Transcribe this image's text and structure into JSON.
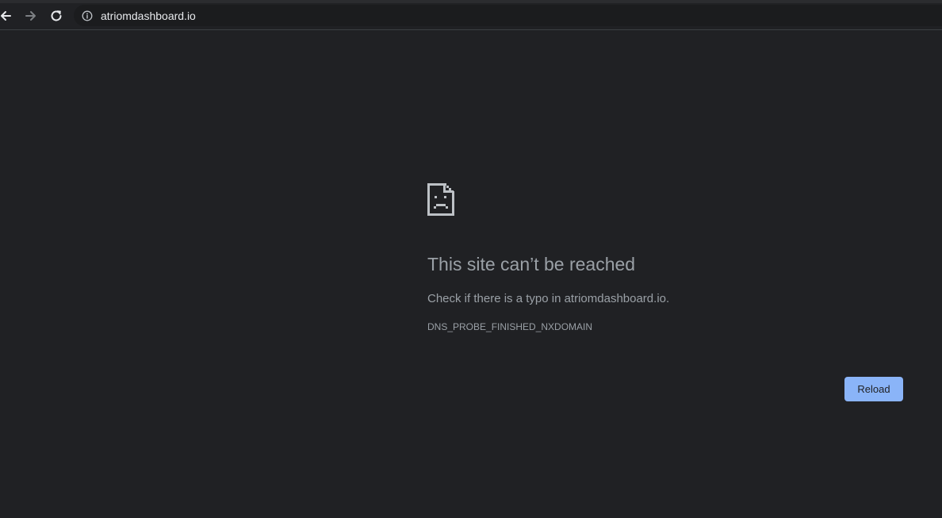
{
  "browser": {
    "url": "atriomdashboard.io",
    "icons": {
      "back": "arrow-left-icon",
      "forward": "arrow-right-icon",
      "reload": "reload-icon",
      "site_info": "info-icon"
    }
  },
  "error_page": {
    "icon": "sad-page-icon",
    "title": "This site can’t be reached",
    "description": "Check if there is a typo in atriomdashboard.io.",
    "error_code": "DNS_PROBE_FINISHED_NXDOMAIN",
    "reload_label": "Reload"
  },
  "colors": {
    "background": "#202124",
    "text_muted": "#9aa0a6",
    "accent": "#8ab4f8"
  }
}
